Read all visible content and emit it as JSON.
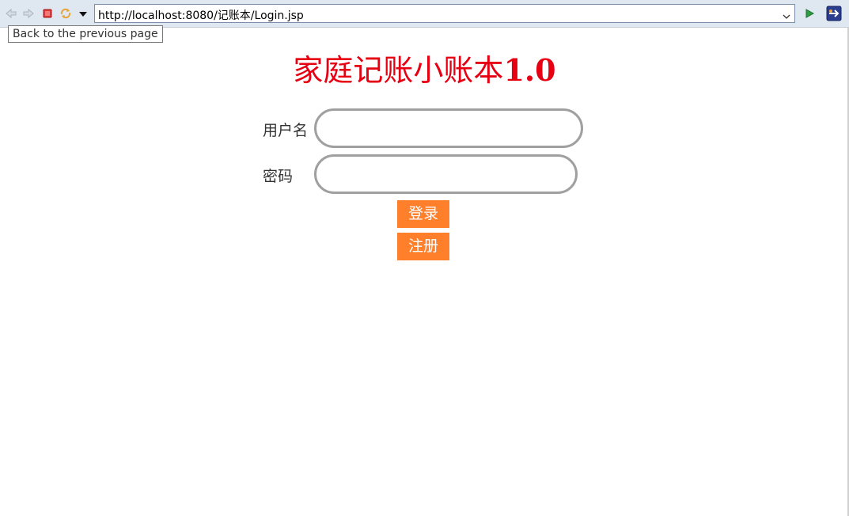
{
  "browser": {
    "url": "http://localhost:8080/记账本/Login.jsp",
    "tooltip": "Back to the previous page"
  },
  "page": {
    "title_main": "家庭记账小账本",
    "title_version": "1.0"
  },
  "form": {
    "username_label": "用户名",
    "password_label": "密码",
    "username_value": "",
    "password_value": "",
    "login_label": "登录",
    "register_label": "注册"
  },
  "colors": {
    "title": "#e60012",
    "button": "#ff7f2a",
    "field_border": "#a0a0a0"
  }
}
